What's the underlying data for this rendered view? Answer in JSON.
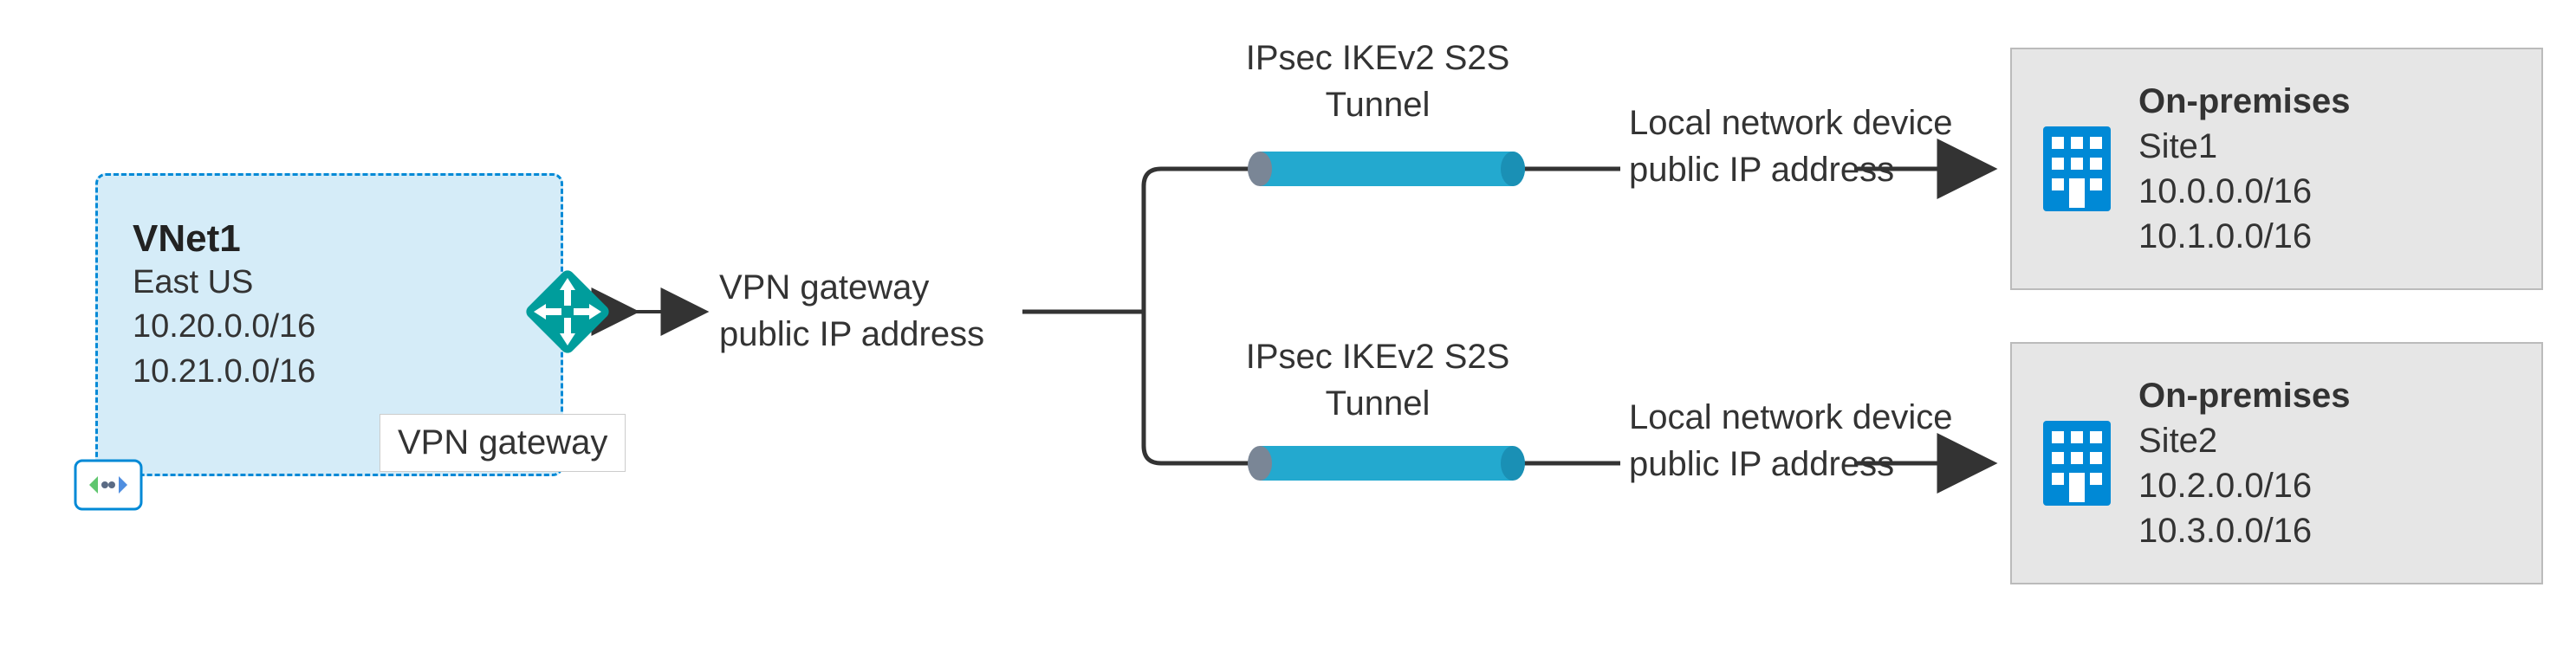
{
  "vnet": {
    "title": "VNet1",
    "region": "East US",
    "cidr1": "10.20.0.0/16",
    "cidr2": "10.21.0.0/16",
    "vpn_gateway_box_label": "VPN gateway"
  },
  "gateway_label": {
    "line1": "VPN gateway",
    "line2": "public IP address"
  },
  "tunnel_label_top": {
    "line1": "IPsec IKEv2 S2S",
    "line2": "Tunnel"
  },
  "tunnel_label_bottom": {
    "line1": "IPsec IKEv2 S2S",
    "line2": "Tunnel"
  },
  "local_device_top": {
    "line1": "Local network device",
    "line2": "public IP address"
  },
  "local_device_bottom": {
    "line1": "Local network device",
    "line2": "public IP address"
  },
  "site_top": {
    "title": "On-premises",
    "name": "Site1",
    "cidr1": "10.0.0.0/16",
    "cidr2": "10.1.0.0/16"
  },
  "site_bottom": {
    "title": "On-premises",
    "name": "Site2",
    "cidr1": "10.2.0.0/16",
    "cidr2": "10.3.0.0/16"
  },
  "colors": {
    "azure_blue": "#0089d6",
    "vnet_fill": "#d5ecf8",
    "tunnel": "#23a9cf",
    "teal": "#009d9c",
    "grey_box": "#e6e6e6"
  }
}
